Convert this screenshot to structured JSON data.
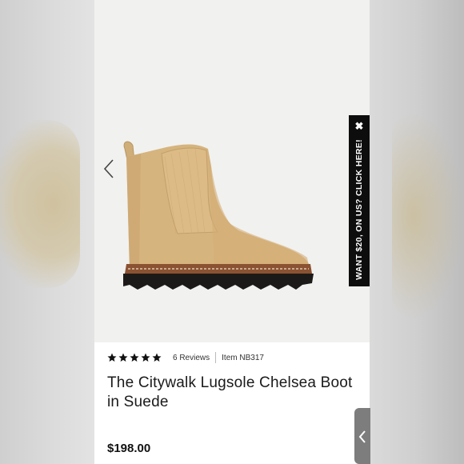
{
  "promo": {
    "text": "WANT $20, ON US? CLICK HERE!",
    "close_symbol": "✖"
  },
  "product": {
    "rating_stars": 5,
    "reviews": "6 Reviews",
    "item_number": "Item NB317",
    "title": "The Citywalk Lugsole Chelsea Boot in Suede",
    "price": "$198.00"
  },
  "icons": {
    "prev": "chevron-left-icon",
    "drawer": "chevron-left-icon",
    "star": "star-icon"
  },
  "colors": {
    "suede": "#d6b47e",
    "sole": "#1c1a18",
    "welt": "#8a5232",
    "promo_bg": "#0d0d0d",
    "drawer_tab": "#7d7d7d"
  }
}
